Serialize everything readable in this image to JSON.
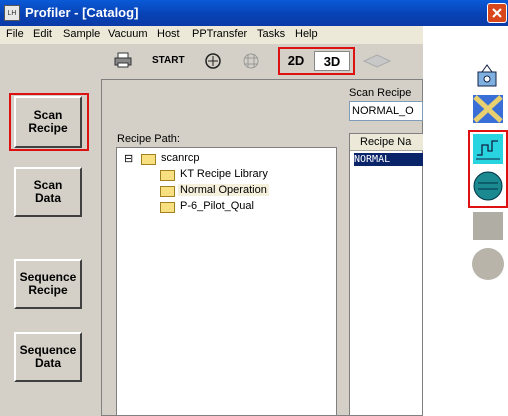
{
  "window": {
    "title": "Profiler - [Catalog]",
    "icon_text": "LH"
  },
  "menu": [
    "File",
    "Edit",
    "Sample",
    "Vacuum",
    "Host",
    "PPTransfer",
    "Tasks",
    "Help"
  ],
  "toolbar": {
    "start_label": "START",
    "btn_2d": "2D",
    "btn_3d": "3D"
  },
  "sidebar": {
    "items": [
      {
        "label_1": "Scan",
        "label_2": "Recipe"
      },
      {
        "label_1": "Scan",
        "label_2": "Data"
      },
      {
        "label_1": "Sequence",
        "label_2": "Recipe"
      },
      {
        "label_1": "Sequence",
        "label_2": "Data"
      }
    ]
  },
  "recipe_path": {
    "label": "Recipe Path:",
    "tree": {
      "root": "scanrcp",
      "expander": "⊟",
      "children": [
        "KT Recipe Library",
        "Normal Operation",
        "P-6_Pilot_Qual"
      ]
    }
  },
  "scan_recipe": {
    "label": "Scan Recipe",
    "value": "NORMAL_O"
  },
  "recipe_list": {
    "header": "Recipe Na",
    "selected": "NORMAL"
  },
  "colors": {
    "title_bar": "#0842b4",
    "highlight": "#d11111",
    "selection": "#0a246a"
  }
}
